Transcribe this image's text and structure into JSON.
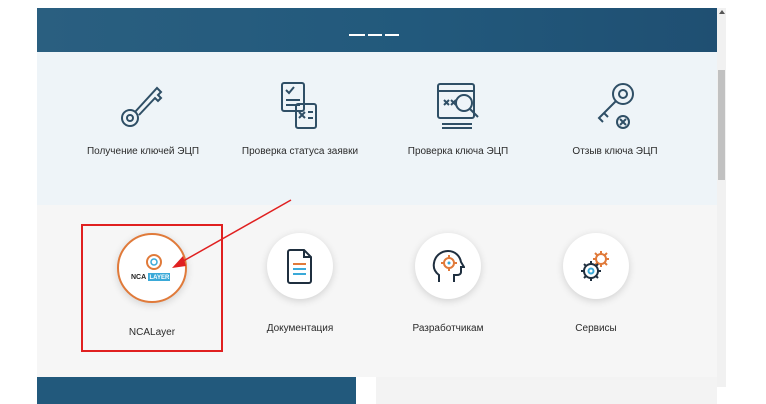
{
  "services": {
    "items": [
      {
        "label": "Получение ключей ЭЦП",
        "icon": "key-icon"
      },
      {
        "label": "Проверка статуса заявки",
        "icon": "document-check-icon"
      },
      {
        "label": "Проверка ключа ЭЦП",
        "icon": "browser-key-check-icon"
      },
      {
        "label": "Отзыв ключа ЭЦП",
        "icon": "key-revoke-icon"
      }
    ]
  },
  "tools": {
    "items": [
      {
        "label": "NCALayer",
        "icon": "ncalayer-logo-icon",
        "logo_text": [
          "NCA",
          "LAYER"
        ]
      },
      {
        "label": "Документация",
        "icon": "document-icon"
      },
      {
        "label": "Разработчикам",
        "icon": "head-gear-icon"
      },
      {
        "label": "Сервисы",
        "icon": "gears-icon"
      }
    ]
  },
  "colors": {
    "header": "#22597c",
    "services_bg": "#eef4f8",
    "icon_stroke": "#2f4f66",
    "accent_orange": "#e07a3a",
    "annotation_red": "#e02020"
  }
}
